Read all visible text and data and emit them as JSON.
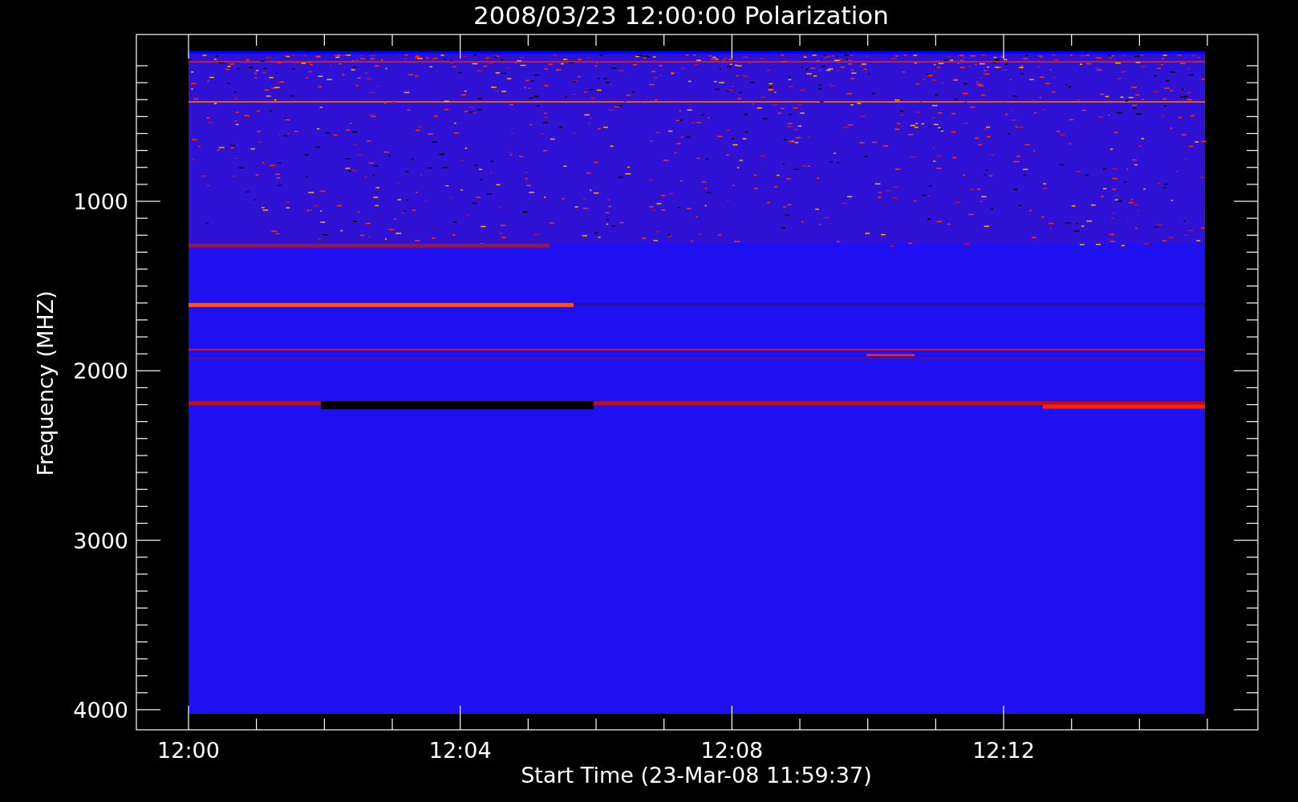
{
  "chart": {
    "title": "2008/03/23 12:00:00 Polarization",
    "ylabel": "Frequency (MHZ)",
    "xlabel": "Start Time (23-Mar-08 11:59:37)",
    "yticks": [
      "1000",
      "2000",
      "3000",
      "4000"
    ],
    "xticks": [
      "12:00",
      "12:04",
      "12:08",
      "12:12"
    ]
  }
}
